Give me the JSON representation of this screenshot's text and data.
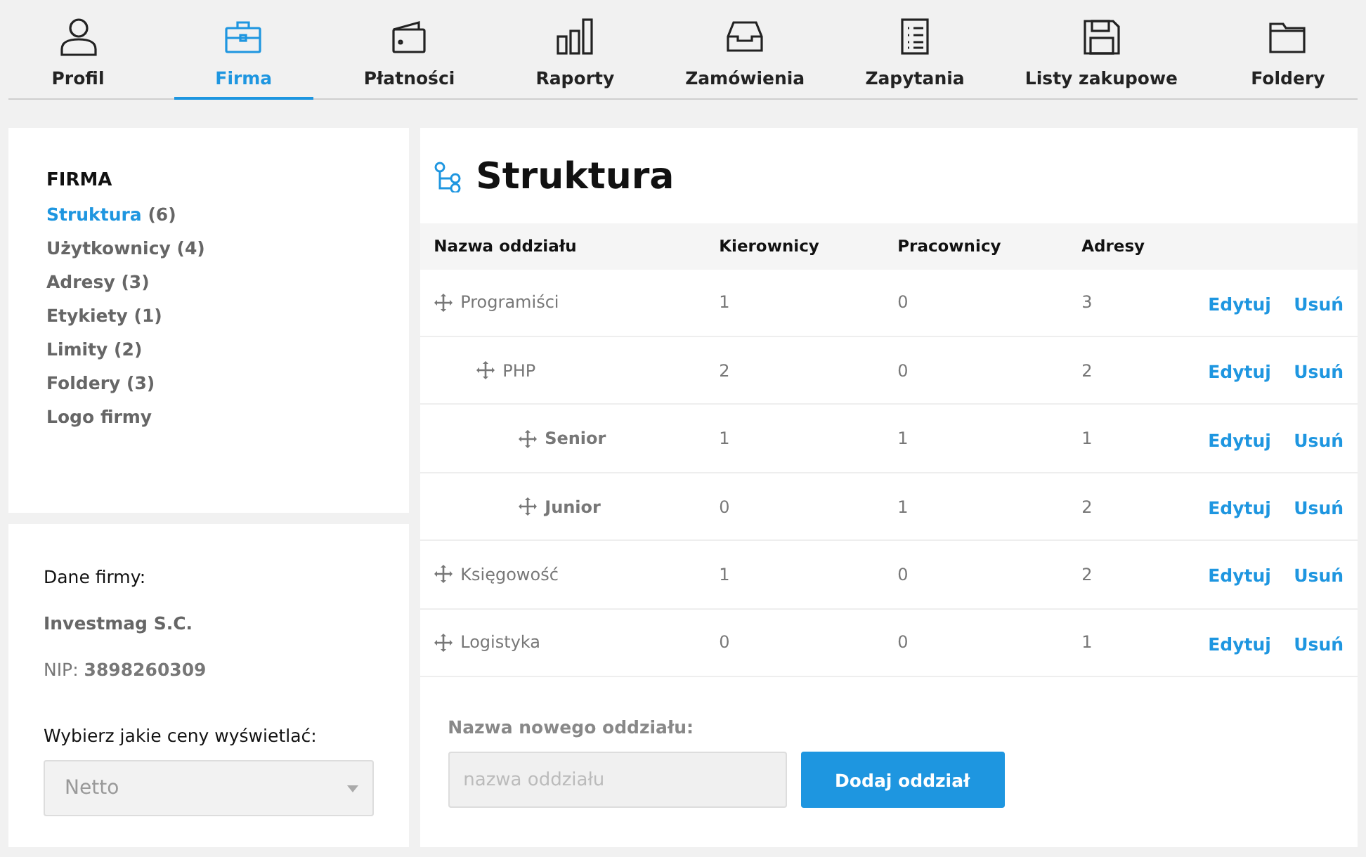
{
  "tabs": [
    {
      "label": "Profil",
      "selected": false
    },
    {
      "label": "Firma",
      "selected": true
    },
    {
      "label": "Płatności",
      "selected": false
    },
    {
      "label": "Raporty",
      "selected": false
    },
    {
      "label": "Zamówienia",
      "selected": false
    },
    {
      "label": "Zapytania",
      "selected": false
    },
    {
      "label": "Listy zakupowe",
      "selected": false
    },
    {
      "label": "Foldery",
      "selected": false
    }
  ],
  "sidebar": {
    "heading": "FIRMA",
    "items": [
      {
        "label": "Struktura",
        "count": "(6)",
        "selected": true
      },
      {
        "label": "Użytkownicy",
        "count": "(4)",
        "selected": false
      },
      {
        "label": "Adresy",
        "count": "(3)",
        "selected": false
      },
      {
        "label": "Etykiety",
        "count": "(1)",
        "selected": false
      },
      {
        "label": "Limity",
        "count": "(2)",
        "selected": false
      },
      {
        "label": "Foldery",
        "count": "(3)",
        "selected": false
      },
      {
        "label": "Logo firmy",
        "selected": false
      }
    ]
  },
  "company": {
    "heading": "Dane firmy:",
    "name": "Investmag S.C.",
    "nip": "NIP: **3898260309**",
    "price_label": "Wybierz jakie ceny wyświetlać:",
    "price_select": {
      "value": "Netto"
    }
  },
  "structure": {
    "title": "Struktura",
    "columns": [
      "Nazwa oddziału",
      "Kierownicy",
      "Pracownicy",
      "Adresy"
    ],
    "rows": [
      {
        "name": "Programiści",
        "managers": "1",
        "employees": "0",
        "addresses": "3",
        "edit": "Edytuj",
        "delete": "Usuń",
        "children": [
          {
            "name": "PHP",
            "managers": "2",
            "employees": "0",
            "addresses": "2",
            "edit": "Edytuj",
            "delete": "Usuń",
            "children": [
              {
                "name": "Senior",
                "managers": "1",
                "employees": "1",
                "addresses": "1",
                "edit": "Edytuj",
                "delete": "Usuń"
              },
              {
                "name": "Junior",
                "managers": "0",
                "employees": "1",
                "addresses": "2",
                "edit": "Edytuj",
                "delete": "Usuń"
              }
            ]
          }
        ]
      },
      {
        "name": "Księgowość",
        "managers": "1",
        "employees": "0",
        "addresses": "2",
        "edit": "Edytuj",
        "delete": "Usuń"
      },
      {
        "name": "Logistyka",
        "managers": "0",
        "employees": "0",
        "addresses": "1",
        "edit": "Edytuj",
        "delete": "Usuń"
      }
    ],
    "new_label": "Nazwa nowego oddziału:",
    "new_field": {
      "placeholder": "nazwa oddziału"
    },
    "add_button": "Dodaj oddział"
  }
}
